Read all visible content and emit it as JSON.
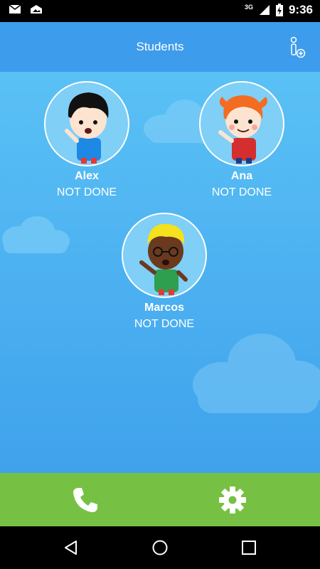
{
  "status_bar": {
    "time": "9:36",
    "network": "3G",
    "icons": [
      "mail-icon",
      "image-icon",
      "signal-icon",
      "battery-charging-icon"
    ]
  },
  "app_bar": {
    "title": "Students",
    "action_icon": "add-user-icon"
  },
  "students": [
    {
      "name": "Alex",
      "status": "NOT DONE"
    },
    {
      "name": "Ana",
      "status": "NOT DONE"
    },
    {
      "name": "Marcos",
      "status": "NOT DONE"
    }
  ],
  "bottom_bar": {
    "buttons": [
      "phone-icon",
      "gear-icon"
    ]
  },
  "nav_bar": {
    "buttons": [
      "back-icon",
      "home-icon",
      "recents-icon"
    ]
  },
  "colors": {
    "app_bar": "#3d9ceb",
    "content_top": "#5ac1f5",
    "bottom_bar": "#76c143",
    "text": "#ffffff"
  }
}
